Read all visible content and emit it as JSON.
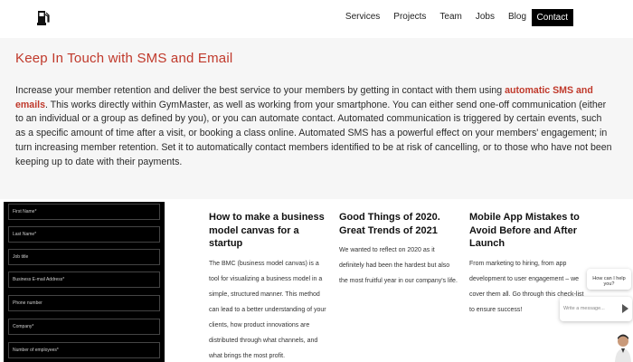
{
  "nav": {
    "items": [
      "Services",
      "Projects",
      "Team",
      "Jobs",
      "Blog"
    ],
    "contact": "Contact"
  },
  "band": {
    "title": "Keep In Touch with SMS and Email",
    "text_before": "Increase your member retention and deliver the best service to your members by getting in contact with them using ",
    "text_bold": "automatic SMS and emails",
    "text_after": ". This works directly within GymMaster, as well as working from your smartphone. You can either send one-off communication (either to an individual or a group as defined by you), or you can automate contact. Automated communication is triggered by certain events, such as a specific amount of time after a visit, or booking a class online. Automated SMS has a powerful effect on your members' engagement; in turn increasing member retention. Set it to automatically contact members identified to be at risk of cancelling, or to those who have not been keeping up to date with their payments."
  },
  "form": {
    "fields": [
      "First Name*",
      "Last Name*",
      "Job title",
      "Business E-mail Address*",
      "Phone number",
      "Company*",
      "Number of employees*"
    ]
  },
  "articles": [
    {
      "title": "How to make a business model canvas for a startup",
      "excerpt": "The BMC (business model canvas) is a tool for visualizing a business model in a simple, structured manner. This method can lead to a better understanding of your clients, how product innovations are distributed through what channels, and what brings the most profit."
    },
    {
      "title": "Good Things of 2020. Great Trends of 2021",
      "excerpt": "We wanted to reflect on 2020 as it definitely had been the hardest but also the most fruitful year in our company's life."
    },
    {
      "title": "Mobile App Mistakes to Avoid Before and After Launch",
      "excerpt": "From marketing to hiring, from app development to user engagement – we cover them all. Go through this check-list to ensure success!"
    }
  ],
  "chat": {
    "prompt": "How can I help you?",
    "placeholder": "Write a message..."
  },
  "colors": {
    "accent": "#c0392b",
    "form_bg": "#000000",
    "band_bg": "#f6f6f6"
  }
}
